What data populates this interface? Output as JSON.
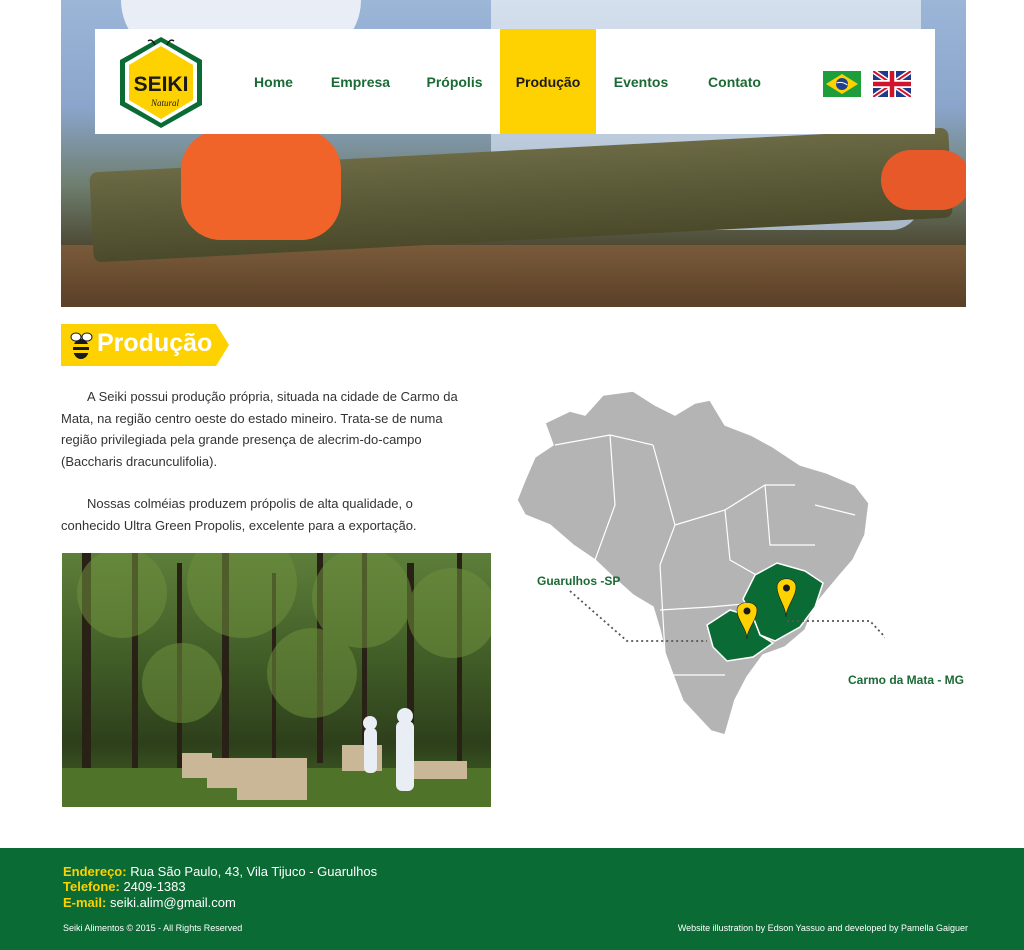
{
  "brand": {
    "name": "SEIKI",
    "tagline": "Natural",
    "colors": {
      "green": "#0b6b34",
      "yellow": "#fed100"
    }
  },
  "nav": {
    "items": [
      {
        "label": "Home",
        "active": false
      },
      {
        "label": "Empresa",
        "active": false
      },
      {
        "label": "Própolis",
        "active": false
      },
      {
        "label": "Produção",
        "active": true
      },
      {
        "label": "Eventos",
        "active": false
      },
      {
        "label": "Contato",
        "active": false
      }
    ],
    "languages": [
      {
        "icon": "brazil-flag-icon"
      },
      {
        "icon": "uk-flag-icon"
      }
    ]
  },
  "page": {
    "title": "Produção",
    "title_icon": "bee-icon",
    "paragraphs": [
      "A Seiki possui produção própria, situada na cidade de Carmo da Mata, na região centro oeste do estado mineiro. Trata-se de numa região privilegiada pela grande presença de alecrim-do-campo (Baccharis dracunculifolia).",
      "Nossas colméias produzem própolis de alta qualidade, o conhecido Ultra Green Propolis, excelente para a exportação."
    ]
  },
  "map": {
    "labels": {
      "guarulhos": "Guarulhos -SP",
      "carmo": "Carmo da Mata - MG"
    },
    "marker_icon": "location-pin-icon"
  },
  "footer": {
    "address_label": "Endereço:",
    "address_value": "Rua São Paulo, 43, Vila Tijuco - Guarulhos",
    "phone_label": "Telefone:",
    "phone_value": "2409-1383",
    "email_label": "E-mail:",
    "email_value": "seiki.alim@gmail.com",
    "copyright": "Seiki Alimentos © 2015 - All Rights Reserved",
    "credit": "Website illustration by Edson Yassuo and developed by Pamella Gaiguer"
  }
}
